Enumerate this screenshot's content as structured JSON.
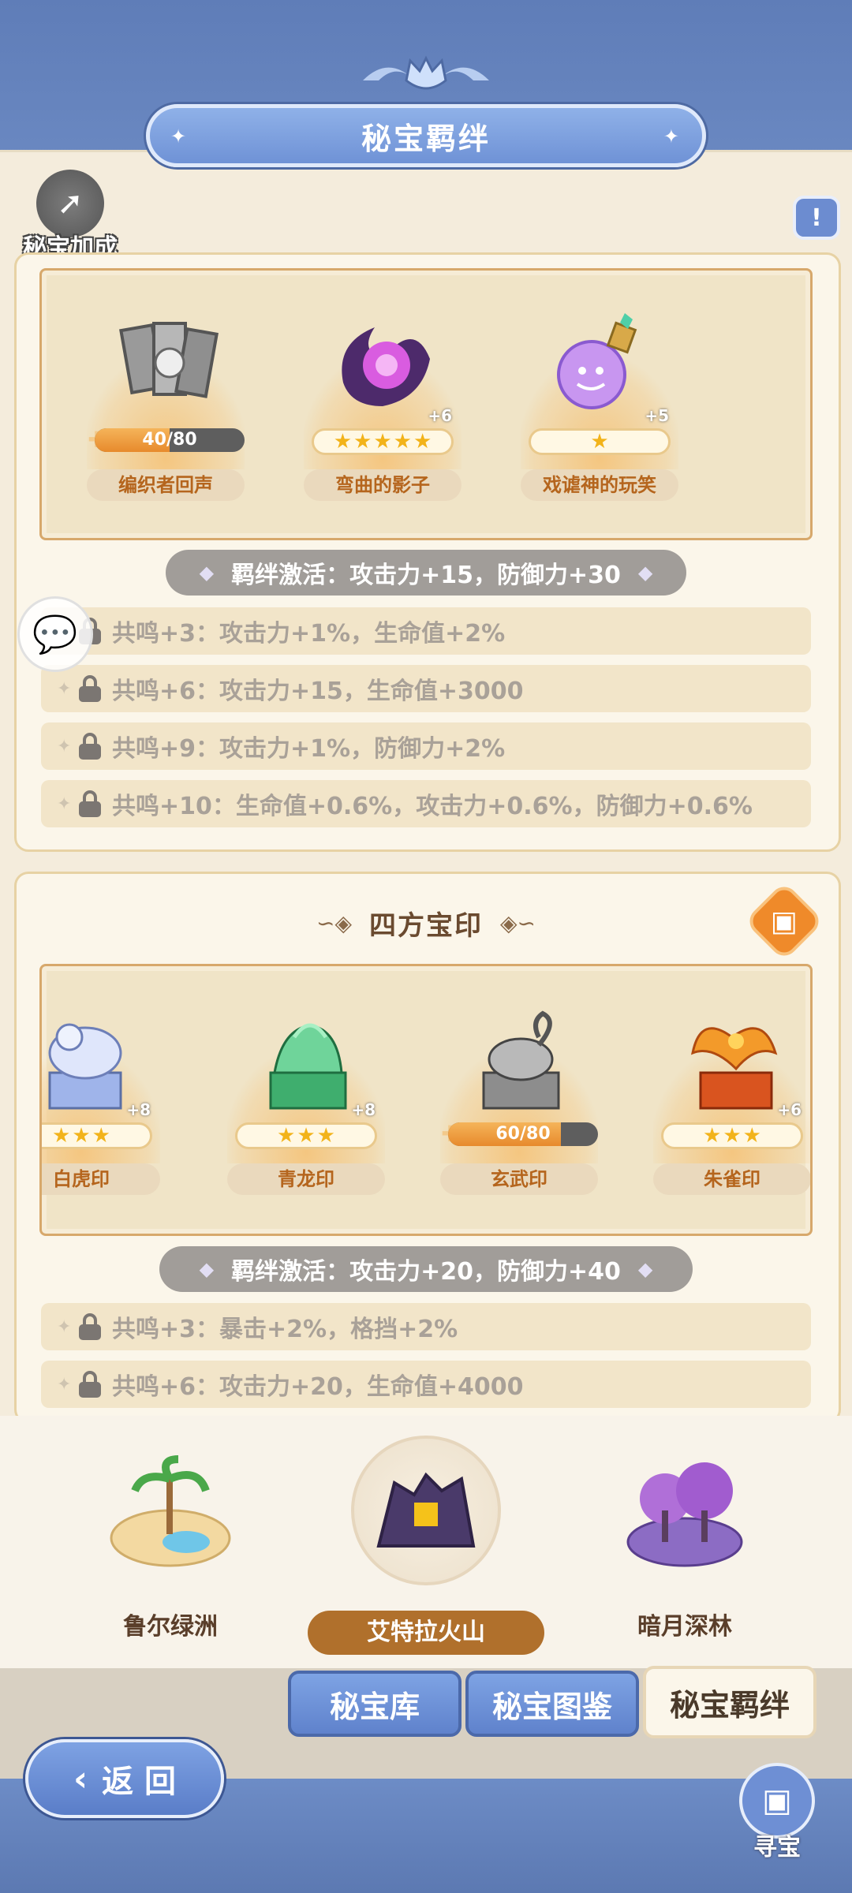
{
  "header": {
    "title": "秘宝羁绊"
  },
  "bonus_button": {
    "label": "秘宝加成",
    "icon": "arrow-up-icon"
  },
  "info_button": {
    "icon": "notice-icon"
  },
  "chat_button": {
    "icon": "chat-bubble-icon"
  },
  "set1": {
    "items": [
      {
        "name": "编织者回声",
        "progress_text": "40/80",
        "progress": 0.5,
        "stars": 0,
        "plus": ""
      },
      {
        "name": "弯曲的影子",
        "progress_text": "",
        "stars": 5,
        "plus": "+6"
      },
      {
        "name": "戏谑神的玩笑",
        "progress_text": "",
        "stars": 1,
        "plus": "+5"
      }
    ],
    "bond": "羁绊激活：攻击力+15，防御力+30",
    "resonances": [
      "共鸣+3：攻击力+1%，生命值+2%",
      "共鸣+6：攻击力+15，生命值+3000",
      "共鸣+9：攻击力+1%，防御力+2%",
      "共鸣+10：生命值+0.6%，攻击力+0.6%，防御力+0.6%"
    ]
  },
  "set2": {
    "title": "四方宝印",
    "items": [
      {
        "name": "白虎印",
        "stars": 3,
        "plus": "+8",
        "progress_text": ""
      },
      {
        "name": "青龙印",
        "stars": 3,
        "plus": "+8",
        "progress_text": ""
      },
      {
        "name": "玄武印",
        "stars": 0,
        "plus": "",
        "progress_text": "60/80",
        "progress": 0.75
      },
      {
        "name": "朱雀印",
        "stars": 3,
        "plus": "+6",
        "progress_text": ""
      }
    ],
    "bond": "羁绊激活：攻击力+20，防御力+40",
    "resonances": [
      "共鸣+3：暴击+2%，格挡+2%",
      "共鸣+6：攻击力+20，生命值+4000"
    ]
  },
  "regions": [
    {
      "name": "鲁尔绿洲",
      "active": false
    },
    {
      "name": "艾特拉火山",
      "active": true
    },
    {
      "name": "暗月深林",
      "active": false
    }
  ],
  "tabs": [
    {
      "label": "秘宝库",
      "selected": false
    },
    {
      "label": "秘宝图鉴",
      "selected": false
    },
    {
      "label": "秘宝羁绊",
      "selected": true
    }
  ],
  "back_button": {
    "label": "返 回"
  },
  "seek_button": {
    "label": "寻宝"
  },
  "colors": {
    "accent_blue": "#6f92d6",
    "parchment": "#f4ecdc",
    "orange": "#e78a2c",
    "star": "#f2b31a"
  }
}
